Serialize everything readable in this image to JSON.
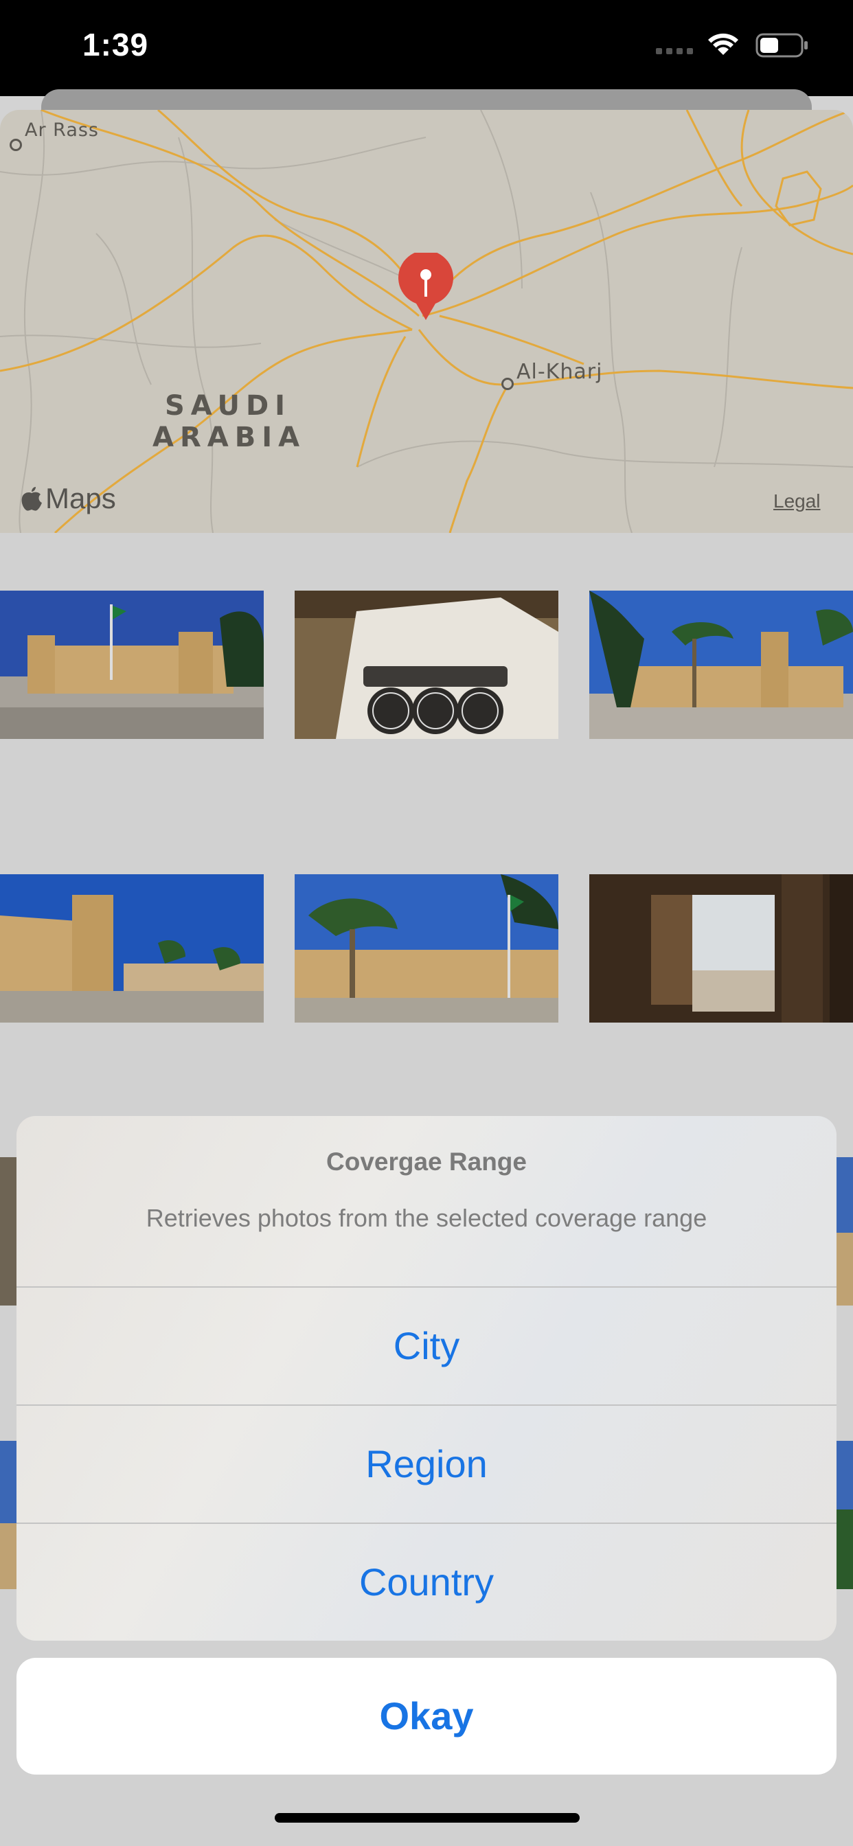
{
  "status_bar": {
    "time": "1:39"
  },
  "map": {
    "labels": {
      "ar_rass": "Ar Rass",
      "al_kharj": "Al-Kharj",
      "country_line1": "SAUDI",
      "country_line2": "ARABIA"
    },
    "maps_brand": "Maps",
    "legal": "Legal"
  },
  "action_sheet": {
    "title": "Covergae Range",
    "message": "Retrieves photos from the selected coverage range",
    "options": [
      "City",
      "Region",
      "Country"
    ],
    "confirm": "Okay"
  },
  "colors": {
    "accent": "#1874e4",
    "pin": "#d9463a",
    "roads": "#e3a93d"
  },
  "icons": [
    "wifi-icon",
    "battery-icon",
    "map-pin-icon",
    "apple-logo-icon"
  ]
}
